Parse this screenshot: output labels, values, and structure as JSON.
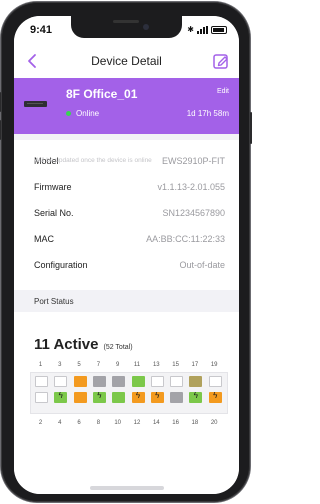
{
  "status_bar": {
    "time": "9:41"
  },
  "nav": {
    "title": "Device Detail"
  },
  "device": {
    "name": "8F Office_01",
    "edit_label": "Edit",
    "status": "Online",
    "uptime": "1d 17h 58m"
  },
  "info": [
    {
      "key": "Model",
      "value": "EWS2910P-FIT"
    },
    {
      "key": "Firmware",
      "value": "v1.1.13-2.01.055"
    },
    {
      "key": "Serial No.",
      "value": "SN1234567890"
    },
    {
      "key": "MAC",
      "value": "AA:BB:CC:11:22:33"
    },
    {
      "key": "Configuration",
      "value": "Out-of-date"
    }
  ],
  "config_note": "Will be updated once the device is online",
  "ports": {
    "section_label": "Port Status",
    "active_label": "11 Active",
    "total_label": "(52 Total)",
    "top_numbers": [
      "1",
      "3",
      "5",
      "7",
      "9",
      "11",
      "13",
      "15",
      "17",
      "19"
    ],
    "bottom_numbers": [
      "2",
      "4",
      "6",
      "8",
      "10",
      "12",
      "14",
      "16",
      "18",
      "20"
    ],
    "top_row": [
      {
        "state": "empty",
        "poe": false
      },
      {
        "state": "empty",
        "poe": false
      },
      {
        "state": "orange",
        "poe": false
      },
      {
        "state": "gray",
        "poe": false
      },
      {
        "state": "gray",
        "poe": false
      },
      {
        "state": "green",
        "poe": false
      },
      {
        "state": "empty",
        "poe": false
      },
      {
        "state": "empty",
        "poe": false
      },
      {
        "state": "olive",
        "poe": false
      },
      {
        "state": "empty",
        "poe": false
      }
    ],
    "bottom_row": [
      {
        "state": "empty",
        "poe": false
      },
      {
        "state": "green",
        "poe": true
      },
      {
        "state": "orange",
        "poe": false
      },
      {
        "state": "green",
        "poe": true
      },
      {
        "state": "green",
        "poe": false
      },
      {
        "state": "orange",
        "poe": true
      },
      {
        "state": "orange",
        "poe": true
      },
      {
        "state": "gray",
        "poe": false
      },
      {
        "state": "green",
        "poe": true
      },
      {
        "state": "orange",
        "poe": true
      }
    ]
  },
  "colors": {
    "accent_purple": "#a361e8",
    "online_green": "#39d353",
    "port_orange": "#f39a1f",
    "port_green": "#7cc84a",
    "port_gray": "#a3a3a8"
  }
}
